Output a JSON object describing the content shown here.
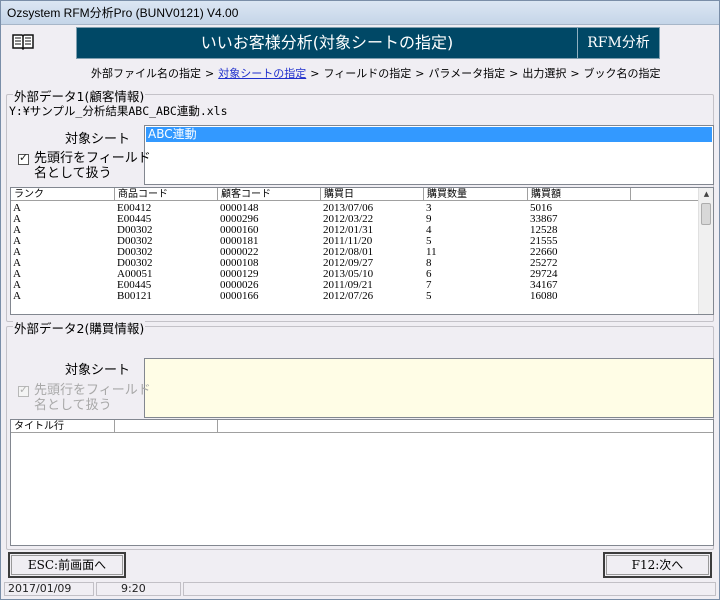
{
  "window": {
    "title": "Ozsystem RFM分析Pro (BUNV0121)   V4.00"
  },
  "header": {
    "title": "いいお客様分析(対象シートの指定)",
    "tag": "RFM分析"
  },
  "breadcrumb": {
    "items": [
      {
        "label": "外部ファイル名の指定"
      },
      {
        "label": "対象シートの指定"
      },
      {
        "label": "フィールドの指定"
      },
      {
        "label": "パラメータ指定"
      },
      {
        "label": "出力選択"
      },
      {
        "label": "ブック名の指定"
      }
    ],
    "separator": ">"
  },
  "group1": {
    "label": "外部データ1(顧客情報)",
    "path": "Y:¥サンプル_分析結果ABC_ABC連動.xls",
    "sheet_label": "対象シート",
    "sheets": [
      "ABC連動"
    ],
    "header_checkbox": {
      "label": "先頭行をフィールド名として扱う",
      "checked": true
    },
    "grid": {
      "columns": [
        "ランク",
        "商品コード",
        "顧客コード",
        "購買日",
        "購買数量",
        "購買額"
      ],
      "rows": [
        [
          "A",
          "E00412",
          "0000148",
          "2013/07/06",
          "3",
          "5016"
        ],
        [
          "A",
          "E00445",
          "0000296",
          "2012/03/22",
          "9",
          "33867"
        ],
        [
          "A",
          "D00302",
          "0000160",
          "2012/01/31",
          "4",
          "12528"
        ],
        [
          "A",
          "D00302",
          "0000181",
          "2011/11/20",
          "5",
          "21555"
        ],
        [
          "A",
          "D00302",
          "0000022",
          "2012/08/01",
          "11",
          "22660"
        ],
        [
          "A",
          "D00302",
          "0000108",
          "2012/09/27",
          "8",
          "25272"
        ],
        [
          "A",
          "A00051",
          "0000129",
          "2013/05/10",
          "6",
          "29724"
        ],
        [
          "A",
          "E00445",
          "0000026",
          "2011/09/21",
          "7",
          "34167"
        ],
        [
          "A",
          "B00121",
          "0000166",
          "2012/07/26",
          "5",
          "16080"
        ]
      ]
    }
  },
  "group2": {
    "label": "外部データ2(購買情報)",
    "sheet_label": "対象シート",
    "header_checkbox": {
      "label": "先頭行をフィールド名として扱う",
      "checked": true,
      "disabled": true
    },
    "grid": {
      "columns": [
        "タイトル行",
        "",
        ""
      ]
    }
  },
  "buttons": {
    "back": "ESC:前画面へ",
    "next": "F12:次へ"
  },
  "status": {
    "date": "2017/01/09",
    "time": "9:20"
  },
  "colors": {
    "header_bg": "#004866",
    "selection": "#3399ff",
    "link": "#1f2fcc",
    "yellow_list": "#fffde6"
  }
}
